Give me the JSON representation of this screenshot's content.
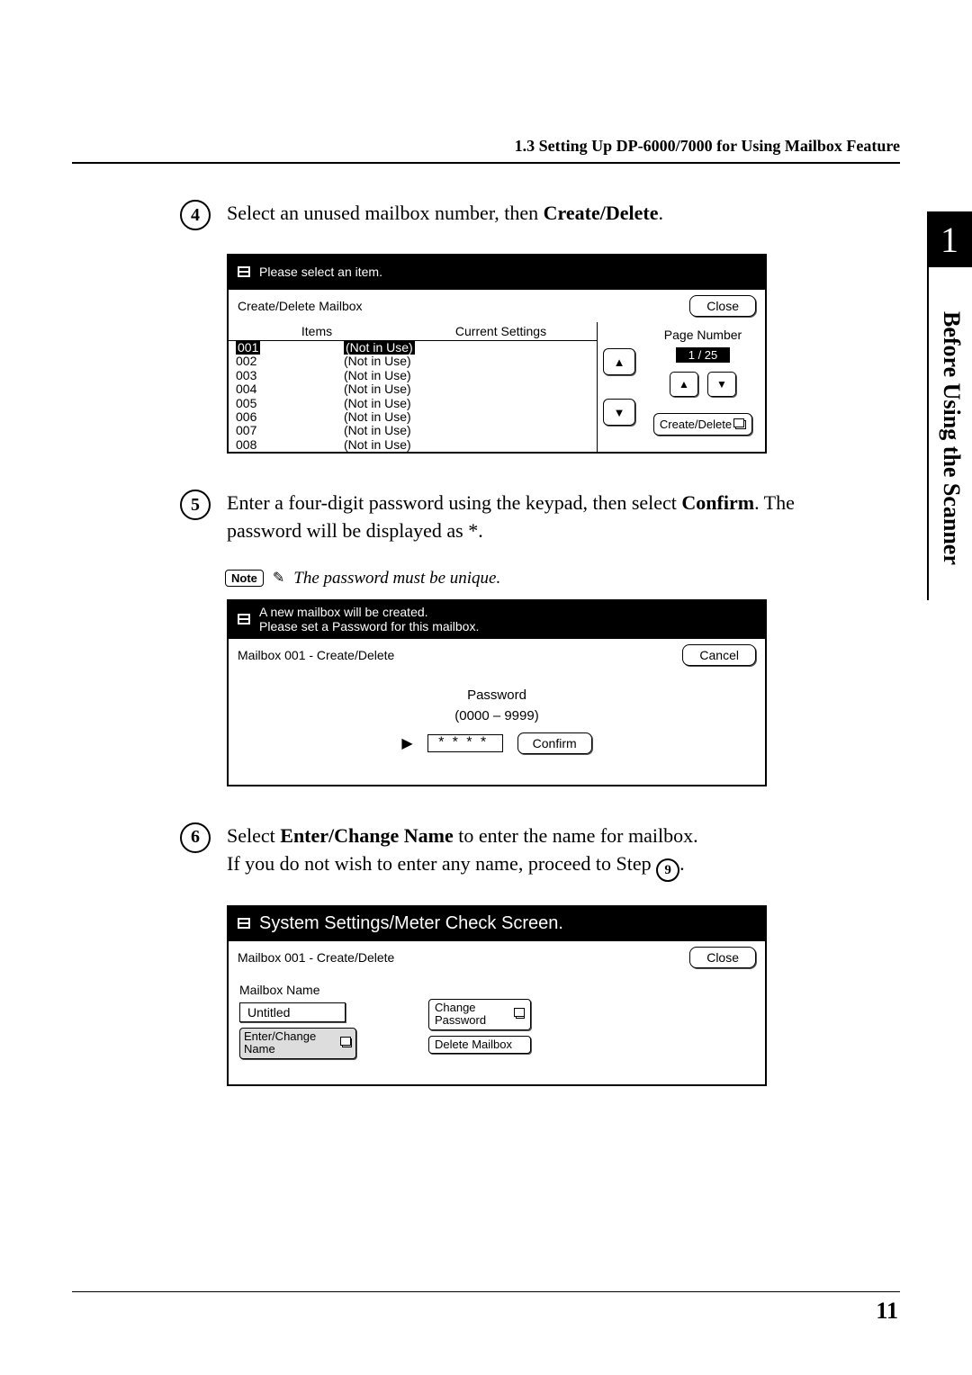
{
  "header": {
    "section": "1.3 Setting Up DP-6000/7000 for Using Mailbox Feature"
  },
  "side_tab": {
    "chapter_number": "1",
    "chapter_title": "Before Using the Scanner"
  },
  "steps": {
    "s4": {
      "number": "4",
      "text_before": "Select an unused mailbox number, then ",
      "text_bold": "Create/Delete",
      "text_after": "."
    },
    "s5": {
      "number": "5",
      "text_before": "Enter a four-digit password using the keypad, then select ",
      "text_bold": "Confirm",
      "text_after": ". The password will be displayed as *.",
      "note_label": "Note",
      "note_text": "The password must be unique."
    },
    "s6": {
      "number": "6",
      "text_before": "Select ",
      "text_bold": "Enter/Change Name",
      "text_mid": " to enter the name for mailbox.",
      "text_line2_before": "If you do not wish to enter any name, proceed to Step ",
      "text_line2_step": "9",
      "text_line2_after": "."
    }
  },
  "screen4": {
    "title": "Please select an item.",
    "subtitle": "Create/Delete Mailbox",
    "close": "Close",
    "items_label": "Items",
    "current_label": "Current Settings",
    "page_number_label": "Page Number",
    "page_counter": "1 / 25",
    "create_delete": "Create/Delete",
    "rows": [
      {
        "num": "001",
        "status": "(Not in Use)"
      },
      {
        "num": "002",
        "status": "(Not in Use)"
      },
      {
        "num": "003",
        "status": "(Not in Use)"
      },
      {
        "num": "004",
        "status": "(Not in Use)"
      },
      {
        "num": "005",
        "status": "(Not in Use)"
      },
      {
        "num": "006",
        "status": "(Not in Use)"
      },
      {
        "num": "007",
        "status": "(Not in Use)"
      },
      {
        "num": "008",
        "status": "(Not in Use)"
      }
    ]
  },
  "screen5": {
    "title_line1": "A new mailbox will be created.",
    "title_line2": "Please set a Password for this mailbox.",
    "subtitle": "Mailbox 001 - Create/Delete",
    "cancel": "Cancel",
    "password_label": "Password",
    "password_range": "(0000 – 9999)",
    "password_value": "****",
    "confirm": "Confirm"
  },
  "screen6": {
    "title": "System Settings/Meter Check Screen.",
    "subtitle": "Mailbox 001 - Create/Delete",
    "close": "Close",
    "mailbox_name_label": "Mailbox Name",
    "mailbox_name_value": "Untitled",
    "enter_change": "Enter/Change Name",
    "change_password": "Change Password",
    "delete_mailbox": "Delete Mailbox"
  },
  "footer": {
    "page_number": "11"
  }
}
